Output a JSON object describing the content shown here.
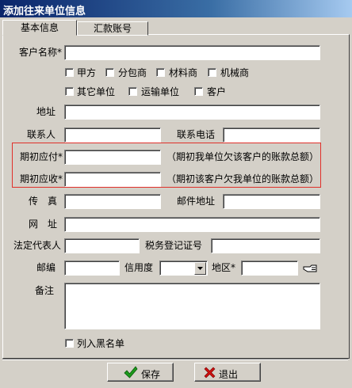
{
  "window": {
    "title": "添加往来单位信息"
  },
  "tabs": [
    {
      "label": "基本信息"
    },
    {
      "label": "汇款账号"
    }
  ],
  "form": {
    "customer_name": {
      "label": "客户名称*",
      "value": ""
    },
    "types": [
      {
        "label": "甲方",
        "checked": false
      },
      {
        "label": "分包商",
        "checked": false
      },
      {
        "label": "材料商",
        "checked": false
      },
      {
        "label": "机械商",
        "checked": false
      },
      {
        "label": "其它单位",
        "checked": false
      },
      {
        "label": "运输单位",
        "checked": false
      },
      {
        "label": "客户",
        "checked": false
      }
    ],
    "address": {
      "label": "地址",
      "value": ""
    },
    "contact": {
      "label": "联系人",
      "value": ""
    },
    "phone": {
      "label": "联系电话",
      "value": ""
    },
    "initial_payable": {
      "label": "期初应付*",
      "value": "",
      "note": "（期初我单位欠该客户的账款总额）"
    },
    "initial_receivable": {
      "label": "期初应收*",
      "value": "",
      "note": "（期初该客户欠我单位的账款总额）"
    },
    "fax": {
      "label": "传　真",
      "value": ""
    },
    "email": {
      "label": "邮件地址",
      "value": ""
    },
    "website": {
      "label": "网　址",
      "value": ""
    },
    "legal_rep": {
      "label": "法定代表人",
      "value": ""
    },
    "tax_no": {
      "label": "税务登记证号",
      "value": ""
    },
    "postcode": {
      "label": "邮编",
      "value": ""
    },
    "credit": {
      "label": "信用度",
      "value": ""
    },
    "region": {
      "label": "地区*",
      "value": ""
    },
    "remark": {
      "label": "备注",
      "value": ""
    },
    "blacklist": {
      "label": "列入黑名单",
      "checked": false
    }
  },
  "buttons": {
    "save": "保存",
    "exit": "退出"
  },
  "colors": {
    "title_bar": "#0a246a",
    "highlight_border": "#e0302a",
    "save_icon": "#1c9a1c",
    "exit_icon": "#cc1010"
  }
}
